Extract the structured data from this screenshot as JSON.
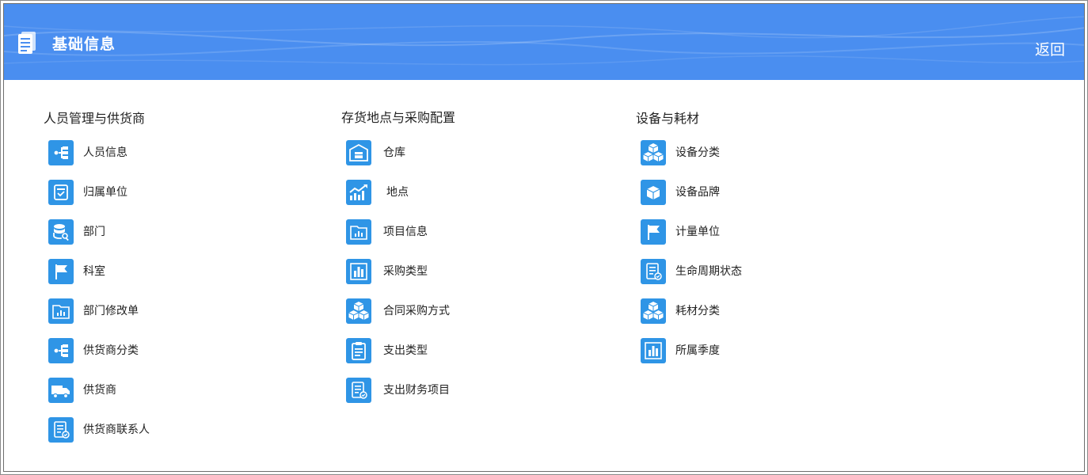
{
  "header": {
    "title": "基础信息",
    "back_label": "返回"
  },
  "columns": [
    {
      "title": "人员管理与供货商",
      "items": [
        {
          "label": "人员信息",
          "icon": "hierarchy-icon"
        },
        {
          "label": "归属单位",
          "icon": "document-icon"
        },
        {
          "label": "部门",
          "icon": "database-search-icon"
        },
        {
          "label": "科室",
          "icon": "flag-icon"
        },
        {
          "label": "部门修改单",
          "icon": "folder-chart-icon"
        },
        {
          "label": "供货商分类",
          "icon": "hierarchy-icon"
        },
        {
          "label": "供货商",
          "icon": "truck-icon"
        },
        {
          "label": "供货商联系人",
          "icon": "form-icon"
        }
      ]
    },
    {
      "title": "存货地点与采购配置",
      "items": [
        {
          "label": "仓库",
          "icon": "warehouse-icon"
        },
        {
          "label": "地点",
          "icon": "chart-trend-icon"
        },
        {
          "label": "项目信息",
          "icon": "folder-chart-icon"
        },
        {
          "label": "采购类型",
          "icon": "bar-chart-icon"
        },
        {
          "label": "合同采购方式",
          "icon": "cubes-icon"
        },
        {
          "label": "支出类型",
          "icon": "clipboard-icon"
        },
        {
          "label": "支出财务项目",
          "icon": "form-icon"
        }
      ]
    },
    {
      "title": "设备与耗材",
      "items": [
        {
          "label": "设备分类",
          "icon": "cubes-icon"
        },
        {
          "label": "设备品牌",
          "icon": "cube-icon"
        },
        {
          "label": "计量单位",
          "icon": "flag-icon"
        },
        {
          "label": "生命周期状态",
          "icon": "form-icon"
        },
        {
          "label": "耗材分类",
          "icon": "cubes-icon"
        },
        {
          "label": "所属季度",
          "icon": "bar-chart-icon"
        }
      ]
    }
  ],
  "colors": {
    "header_bg": "#4a8ef0",
    "icon_bg": "#2f95e6",
    "text": "#222222"
  }
}
